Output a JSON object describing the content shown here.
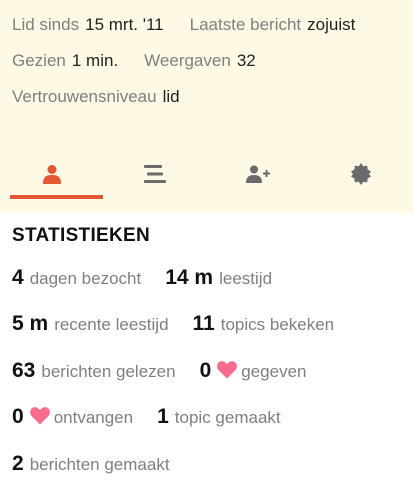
{
  "profile_meta": {
    "member_since_label": "Lid sinds",
    "member_since_value": "15 mrt. '11",
    "last_post_label": "Laatste bericht",
    "last_post_value": "zojuist",
    "seen_label": "Gezien",
    "seen_value": "1 min.",
    "views_label": "Weergaven",
    "views_value": "32",
    "trust_label": "Vertrouwensniveau",
    "trust_value": "lid"
  },
  "tabs": [
    {
      "icon": "user-icon",
      "active": true
    },
    {
      "icon": "list-icon",
      "active": false
    },
    {
      "icon": "user-plus-icon",
      "active": false
    },
    {
      "icon": "badge-icon",
      "active": false
    }
  ],
  "colors": {
    "accent": "#e45735",
    "panel_bg": "#fdf9e4",
    "heart": "#fa6c8d",
    "label_gray": "#7f7f7f",
    "icon_gray": "#6b6b6b"
  },
  "stats": {
    "title": "STATISTIEKEN",
    "days_visited_value": "4",
    "days_visited_label": "dagen bezocht",
    "read_time_value": "14 m",
    "read_time_label": "leestijd",
    "recent_read_time_value": "5 m",
    "recent_read_time_label": "recente leestijd",
    "topics_viewed_value": "11",
    "topics_viewed_label": "topics bekeken",
    "posts_read_value": "63",
    "posts_read_label": "berichten gelezen",
    "likes_given_value": "0",
    "likes_given_label": "gegeven",
    "likes_received_value": "0",
    "likes_received_label": "ontvangen",
    "topics_created_value": "1",
    "topics_created_label": "topic gemaakt",
    "posts_created_value": "2",
    "posts_created_label": "berichten gemaakt"
  }
}
